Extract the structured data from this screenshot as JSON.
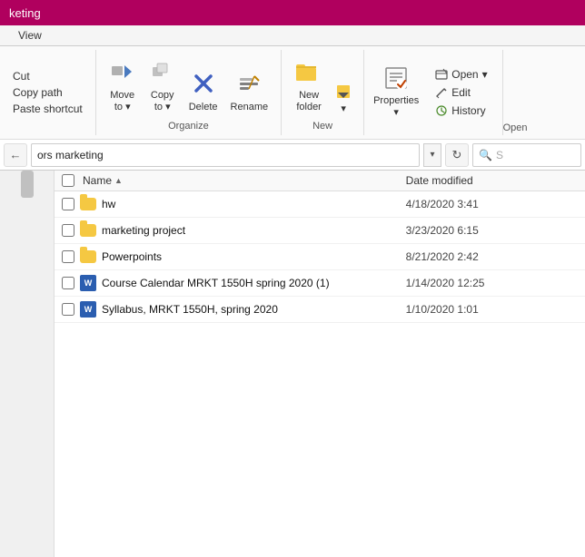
{
  "titleBar": {
    "text": "keting"
  },
  "ribbon": {
    "tabs": [
      "View"
    ],
    "leftCommands": [
      "Cut",
      "Copy path",
      "Paste shortcut"
    ],
    "groups": [
      {
        "name": "Organize",
        "buttons": [
          {
            "id": "move-to",
            "label": "Move\nto",
            "icon": "←"
          },
          {
            "id": "copy-to",
            "label": "Copy\nto",
            "icon": "⧉"
          },
          {
            "id": "delete",
            "label": "Delete",
            "icon": "✕"
          },
          {
            "id": "rename",
            "label": "Rename",
            "icon": "✏"
          }
        ]
      },
      {
        "name": "New",
        "buttons": [
          {
            "id": "new-folder",
            "label": "New\nfolder",
            "icon": "📁"
          }
        ]
      },
      {
        "name": "Open",
        "smallButtons": [
          {
            "id": "open",
            "label": "Open",
            "icon": "↗"
          },
          {
            "id": "edit",
            "label": "Edit",
            "icon": "✎"
          },
          {
            "id": "history",
            "label": "History",
            "icon": "🕐"
          }
        ],
        "bigButtons": [
          {
            "id": "properties",
            "label": "Properties",
            "icon": "☰"
          }
        ]
      }
    ]
  },
  "addressBar": {
    "path": "ors marketing",
    "searchPlaceholder": "S"
  },
  "fileList": {
    "columns": [
      {
        "id": "name",
        "label": "Name"
      },
      {
        "id": "date",
        "label": "Date modified"
      }
    ],
    "items": [
      {
        "type": "folder",
        "name": "hw",
        "date": "4/18/2020 3:41"
      },
      {
        "type": "folder",
        "name": "marketing project",
        "date": "3/23/2020 6:15"
      },
      {
        "type": "folder",
        "name": "Powerpoints",
        "date": "8/21/2020 2:42"
      },
      {
        "type": "word",
        "name": "Course Calendar MRKT 1550H spring 2020 (1)",
        "date": "1/14/2020 12:25"
      },
      {
        "type": "word",
        "name": "Syllabus, MRKT 1550H, spring 2020",
        "date": "1/10/2020 1:01"
      }
    ]
  },
  "icons": {
    "back": "←",
    "dropdown": "▾",
    "refresh": "↻",
    "search": "🔍",
    "sortUp": "▲",
    "open": "↗",
    "edit": "✎"
  }
}
